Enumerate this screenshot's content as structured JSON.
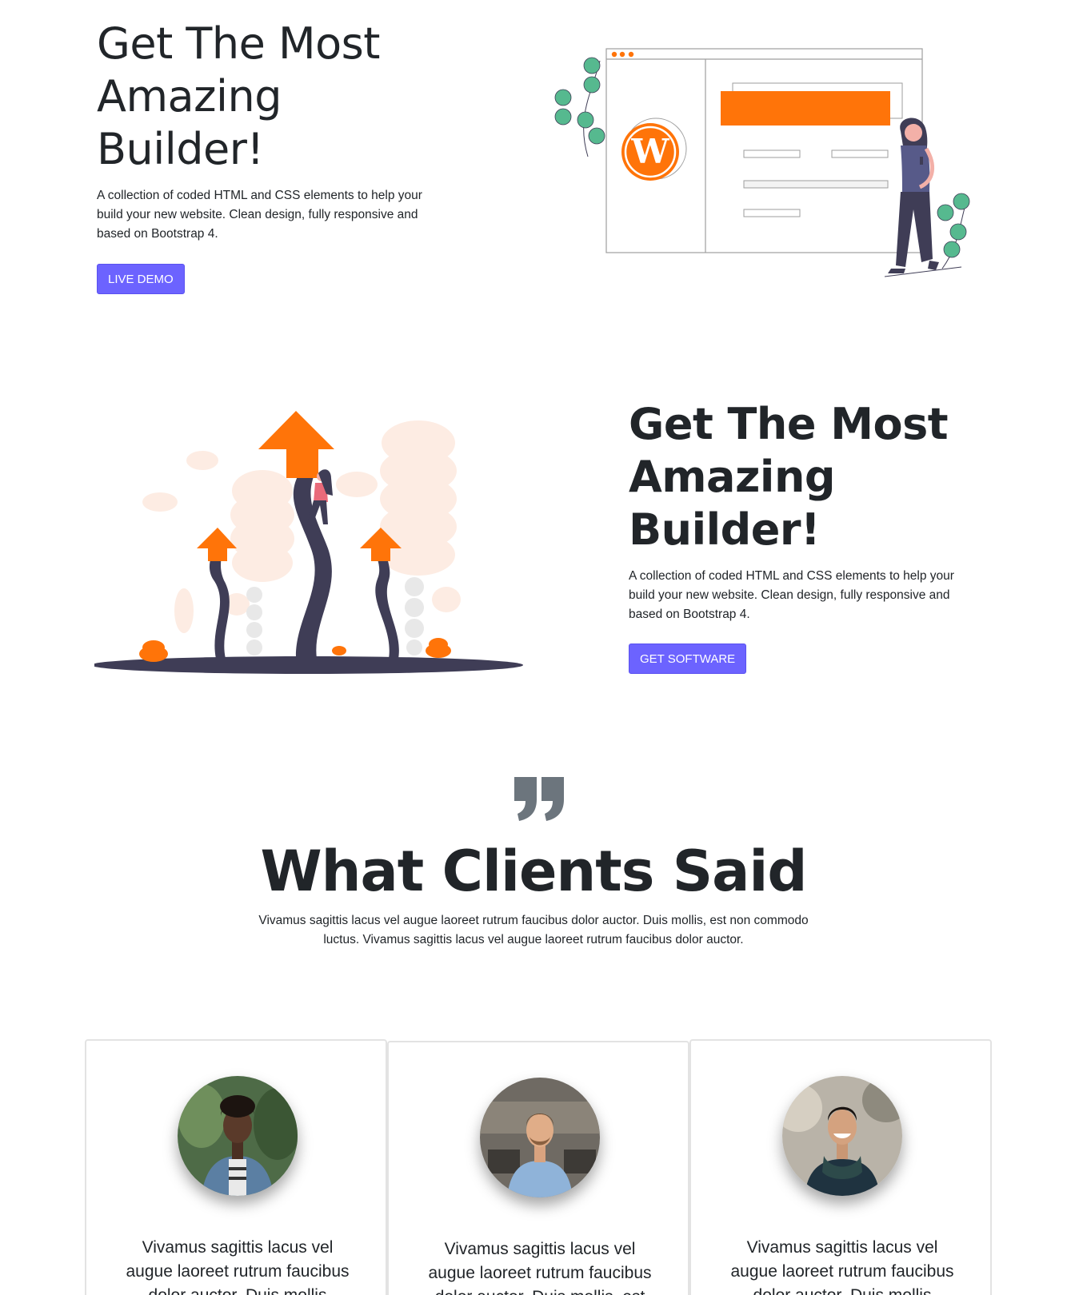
{
  "hero": {
    "title": "Get The Most Amazing Builder!",
    "description": "A collection of coded HTML and CSS elements to help your build your new website. Clean design, fully responsive and based on Bootstrap 4.",
    "button_label": "LIVE DEMO"
  },
  "feature": {
    "title": "Get The Most Amazing Builder!",
    "description": "A collection of coded HTML and CSS elements to help your build your new website. Clean design, fully responsive and based on Bootstrap 4.",
    "button_label": "GET SOFTWARE"
  },
  "testimonials": {
    "title": "What Clients Said",
    "description": "Vivamus sagittis lacus vel augue laoreet rutrum faucibus dolor auctor. Duis mollis, est non commodo luctus. Vivamus sagittis lacus vel augue laoreet rutrum faucibus dolor auctor.",
    "cards": [
      {
        "quote": "Vivamus sagittis lacus vel augue laoreet rutrum faucibus dolor auctor. Duis mollis"
      },
      {
        "quote": "Vivamus sagittis lacus vel augue laoreet rutrum faucibus dolor auctor. Duis mollis, est"
      },
      {
        "quote": "Vivamus sagittis lacus vel augue laoreet rutrum faucibus dolor auctor. Duis mollis"
      }
    ]
  },
  "colors": {
    "accent_button": "#6c63ff",
    "illustration_orange": "#ff7409",
    "illustration_dark": "#3f3d56",
    "plant_green": "#56b98f",
    "quote_icon": "#6c757d"
  },
  "icons": {
    "quote": "quote-icon",
    "wordpress": "wordpress-logo-icon"
  }
}
